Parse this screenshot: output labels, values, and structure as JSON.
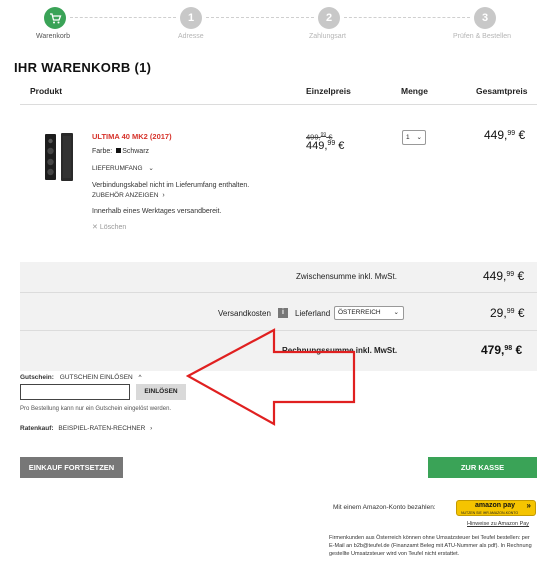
{
  "steps": [
    {
      "number": "",
      "label": "Warenkorb",
      "active": true
    },
    {
      "number": "1",
      "label": "Adresse",
      "active": false
    },
    {
      "number": "2",
      "label": "Zahlungsart",
      "active": false
    },
    {
      "number": "3",
      "label": "Prüfen & Bestellen",
      "active": false
    }
  ],
  "cart_title": "IHR WARENKORB (1)",
  "columns": {
    "product": "Produkt",
    "unit_price": "Einzelpreis",
    "quantity": "Menge",
    "total_price": "Gesamtpreis"
  },
  "item": {
    "name": "ULTIMA 40 MK2 (2017)",
    "color_label": "Farbe:",
    "color_value": "Schwarz",
    "scope_label": "LIEFERUMFANG",
    "cable_note": "Verbindungskabel nicht im Lieferumfang enthalten.",
    "accessory_link": "ZUBEHÖR ANZEIGEN",
    "shipping_note": "Innerhalb eines Werktages versandbereit.",
    "delete_label": "Löschen",
    "old_price_main": "499,",
    "old_price_cents": "99",
    "old_price_sym": "€",
    "price_main": "449,",
    "price_cents": "99",
    "price_sym": "€",
    "quantity": "1",
    "total_main": "449,",
    "total_cents": "99",
    "total_sym": "€"
  },
  "summary": {
    "subtotal_label": "Zwischensumme inkl. MwSt.",
    "subtotal_main": "449,",
    "subtotal_cents": "99",
    "subtotal_sym": "€",
    "shipping_label": "Versandkosten",
    "info_icon": "i",
    "country_label": "Lieferland",
    "country_value": "ÖSTERREICH",
    "shipping_main": "29,",
    "shipping_cents": "99",
    "shipping_sym": "€",
    "invoice_label": "Rechnungssumme inkl. MwSt.",
    "invoice_main": "479,",
    "invoice_cents": "98",
    "invoice_sym": "€"
  },
  "voucher": {
    "label": "Gutschein:",
    "toggle": "GUTSCHEIN EINLÖSEN",
    "input_value": "",
    "button": "EINLÖSEN",
    "note": "Pro Bestellung kann nur ein Gutschein eingelöst werden."
  },
  "installment": {
    "label": "Ratenkauf:",
    "link": "BEISPIEL-RATEN-RECHNER"
  },
  "continue_button": "EINKAUF FORTSETZEN",
  "checkout_button": "ZUR KASSE",
  "amazon": {
    "text": "Mit einem Amazon-Konto bezahlen:",
    "button_main": "amazon pay",
    "button_sub": "NUTZEN SIE IHR AMAZON-KONTO",
    "hint_link": "Hinweise zu Amazon Pay"
  },
  "business_note": "Firmenkunden aus Österreich können ohne Umsatzsteuer bei Teufel bestellen: per E-Mail an b2b@teufel.de (Finanzamt Beleg mit ATU-Nummer als pdf). In Rechnung gestellte Umsatzsteuer wird von Teufel nicht erstattet.",
  "colors": {
    "accent_green": "#3aa357",
    "product_red": "#d6322a",
    "arrow_red": "#e02020",
    "amazon_yellow": "#f5c400"
  },
  "icons": {
    "cart": "cart-icon",
    "arrow": "red-arrow-annotation"
  }
}
